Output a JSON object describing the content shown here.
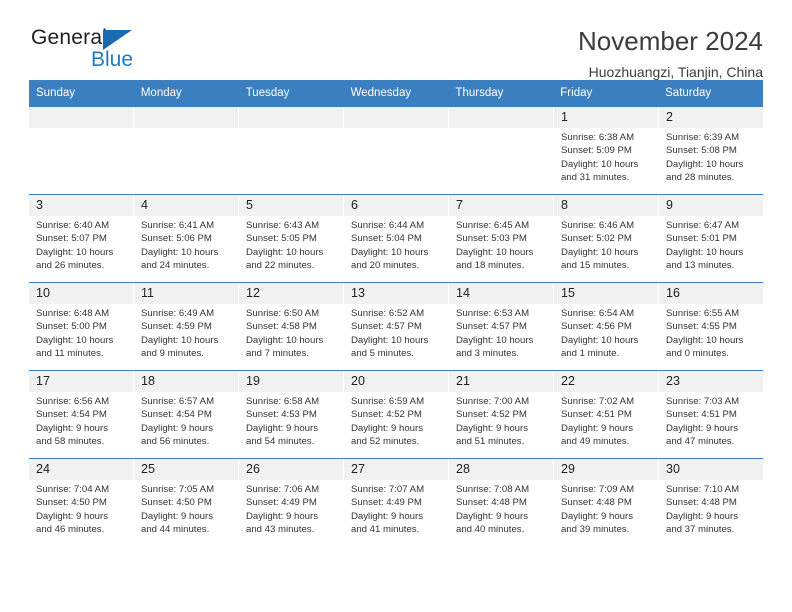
{
  "brand": {
    "name_dark": "General",
    "name_blue": "Blue",
    "triangle_color": "#1a6bb0",
    "blue_color": "#1e7ac4"
  },
  "header": {
    "title": "November 2024",
    "subtitle": "Huozhuangzi, Tianjin, China"
  },
  "theme": {
    "header_blue": "#3c7fc0",
    "day_strip_gray": "#f1f1f1"
  },
  "weekdays": [
    "Sunday",
    "Monday",
    "Tuesday",
    "Wednesday",
    "Thursday",
    "Friday",
    "Saturday"
  ],
  "weeks": [
    [
      {
        "date": "",
        "empty": true,
        "sunrise": "",
        "sunset": "",
        "daylight_1": "",
        "daylight_2": ""
      },
      {
        "date": "",
        "empty": true,
        "sunrise": "",
        "sunset": "",
        "daylight_1": "",
        "daylight_2": ""
      },
      {
        "date": "",
        "empty": true,
        "sunrise": "",
        "sunset": "",
        "daylight_1": "",
        "daylight_2": ""
      },
      {
        "date": "",
        "empty": true,
        "sunrise": "",
        "sunset": "",
        "daylight_1": "",
        "daylight_2": ""
      },
      {
        "date": "",
        "empty": true,
        "sunrise": "",
        "sunset": "",
        "daylight_1": "",
        "daylight_2": ""
      },
      {
        "date": "1",
        "sunrise": "Sunrise: 6:38 AM",
        "sunset": "Sunset: 5:09 PM",
        "daylight_1": "Daylight: 10 hours",
        "daylight_2": "and 31 minutes."
      },
      {
        "date": "2",
        "sunrise": "Sunrise: 6:39 AM",
        "sunset": "Sunset: 5:08 PM",
        "daylight_1": "Daylight: 10 hours",
        "daylight_2": "and 28 minutes."
      }
    ],
    [
      {
        "date": "3",
        "sunrise": "Sunrise: 6:40 AM",
        "sunset": "Sunset: 5:07 PM",
        "daylight_1": "Daylight: 10 hours",
        "daylight_2": "and 26 minutes."
      },
      {
        "date": "4",
        "sunrise": "Sunrise: 6:41 AM",
        "sunset": "Sunset: 5:06 PM",
        "daylight_1": "Daylight: 10 hours",
        "daylight_2": "and 24 minutes."
      },
      {
        "date": "5",
        "sunrise": "Sunrise: 6:43 AM",
        "sunset": "Sunset: 5:05 PM",
        "daylight_1": "Daylight: 10 hours",
        "daylight_2": "and 22 minutes."
      },
      {
        "date": "6",
        "sunrise": "Sunrise: 6:44 AM",
        "sunset": "Sunset: 5:04 PM",
        "daylight_1": "Daylight: 10 hours",
        "daylight_2": "and 20 minutes."
      },
      {
        "date": "7",
        "sunrise": "Sunrise: 6:45 AM",
        "sunset": "Sunset: 5:03 PM",
        "daylight_1": "Daylight: 10 hours",
        "daylight_2": "and 18 minutes."
      },
      {
        "date": "8",
        "sunrise": "Sunrise: 6:46 AM",
        "sunset": "Sunset: 5:02 PM",
        "daylight_1": "Daylight: 10 hours",
        "daylight_2": "and 15 minutes."
      },
      {
        "date": "9",
        "sunrise": "Sunrise: 6:47 AM",
        "sunset": "Sunset: 5:01 PM",
        "daylight_1": "Daylight: 10 hours",
        "daylight_2": "and 13 minutes."
      }
    ],
    [
      {
        "date": "10",
        "sunrise": "Sunrise: 6:48 AM",
        "sunset": "Sunset: 5:00 PM",
        "daylight_1": "Daylight: 10 hours",
        "daylight_2": "and 11 minutes."
      },
      {
        "date": "11",
        "sunrise": "Sunrise: 6:49 AM",
        "sunset": "Sunset: 4:59 PM",
        "daylight_1": "Daylight: 10 hours",
        "daylight_2": "and 9 minutes."
      },
      {
        "date": "12",
        "sunrise": "Sunrise: 6:50 AM",
        "sunset": "Sunset: 4:58 PM",
        "daylight_1": "Daylight: 10 hours",
        "daylight_2": "and 7 minutes."
      },
      {
        "date": "13",
        "sunrise": "Sunrise: 6:52 AM",
        "sunset": "Sunset: 4:57 PM",
        "daylight_1": "Daylight: 10 hours",
        "daylight_2": "and 5 minutes."
      },
      {
        "date": "14",
        "sunrise": "Sunrise: 6:53 AM",
        "sunset": "Sunset: 4:57 PM",
        "daylight_1": "Daylight: 10 hours",
        "daylight_2": "and 3 minutes."
      },
      {
        "date": "15",
        "sunrise": "Sunrise: 6:54 AM",
        "sunset": "Sunset: 4:56 PM",
        "daylight_1": "Daylight: 10 hours",
        "daylight_2": "and 1 minute."
      },
      {
        "date": "16",
        "sunrise": "Sunrise: 6:55 AM",
        "sunset": "Sunset: 4:55 PM",
        "daylight_1": "Daylight: 10 hours",
        "daylight_2": "and 0 minutes."
      }
    ],
    [
      {
        "date": "17",
        "sunrise": "Sunrise: 6:56 AM",
        "sunset": "Sunset: 4:54 PM",
        "daylight_1": "Daylight: 9 hours",
        "daylight_2": "and 58 minutes."
      },
      {
        "date": "18",
        "sunrise": "Sunrise: 6:57 AM",
        "sunset": "Sunset: 4:54 PM",
        "daylight_1": "Daylight: 9 hours",
        "daylight_2": "and 56 minutes."
      },
      {
        "date": "19",
        "sunrise": "Sunrise: 6:58 AM",
        "sunset": "Sunset: 4:53 PM",
        "daylight_1": "Daylight: 9 hours",
        "daylight_2": "and 54 minutes."
      },
      {
        "date": "20",
        "sunrise": "Sunrise: 6:59 AM",
        "sunset": "Sunset: 4:52 PM",
        "daylight_1": "Daylight: 9 hours",
        "daylight_2": "and 52 minutes."
      },
      {
        "date": "21",
        "sunrise": "Sunrise: 7:00 AM",
        "sunset": "Sunset: 4:52 PM",
        "daylight_1": "Daylight: 9 hours",
        "daylight_2": "and 51 minutes."
      },
      {
        "date": "22",
        "sunrise": "Sunrise: 7:02 AM",
        "sunset": "Sunset: 4:51 PM",
        "daylight_1": "Daylight: 9 hours",
        "daylight_2": "and 49 minutes."
      },
      {
        "date": "23",
        "sunrise": "Sunrise: 7:03 AM",
        "sunset": "Sunset: 4:51 PM",
        "daylight_1": "Daylight: 9 hours",
        "daylight_2": "and 47 minutes."
      }
    ],
    [
      {
        "date": "24",
        "sunrise": "Sunrise: 7:04 AM",
        "sunset": "Sunset: 4:50 PM",
        "daylight_1": "Daylight: 9 hours",
        "daylight_2": "and 46 minutes."
      },
      {
        "date": "25",
        "sunrise": "Sunrise: 7:05 AM",
        "sunset": "Sunset: 4:50 PM",
        "daylight_1": "Daylight: 9 hours",
        "daylight_2": "and 44 minutes."
      },
      {
        "date": "26",
        "sunrise": "Sunrise: 7:06 AM",
        "sunset": "Sunset: 4:49 PM",
        "daylight_1": "Daylight: 9 hours",
        "daylight_2": "and 43 minutes."
      },
      {
        "date": "27",
        "sunrise": "Sunrise: 7:07 AM",
        "sunset": "Sunset: 4:49 PM",
        "daylight_1": "Daylight: 9 hours",
        "daylight_2": "and 41 minutes."
      },
      {
        "date": "28",
        "sunrise": "Sunrise: 7:08 AM",
        "sunset": "Sunset: 4:48 PM",
        "daylight_1": "Daylight: 9 hours",
        "daylight_2": "and 40 minutes."
      },
      {
        "date": "29",
        "sunrise": "Sunrise: 7:09 AM",
        "sunset": "Sunset: 4:48 PM",
        "daylight_1": "Daylight: 9 hours",
        "daylight_2": "and 39 minutes."
      },
      {
        "date": "30",
        "sunrise": "Sunrise: 7:10 AM",
        "sunset": "Sunset: 4:48 PM",
        "daylight_1": "Daylight: 9 hours",
        "daylight_2": "and 37 minutes."
      }
    ]
  ]
}
